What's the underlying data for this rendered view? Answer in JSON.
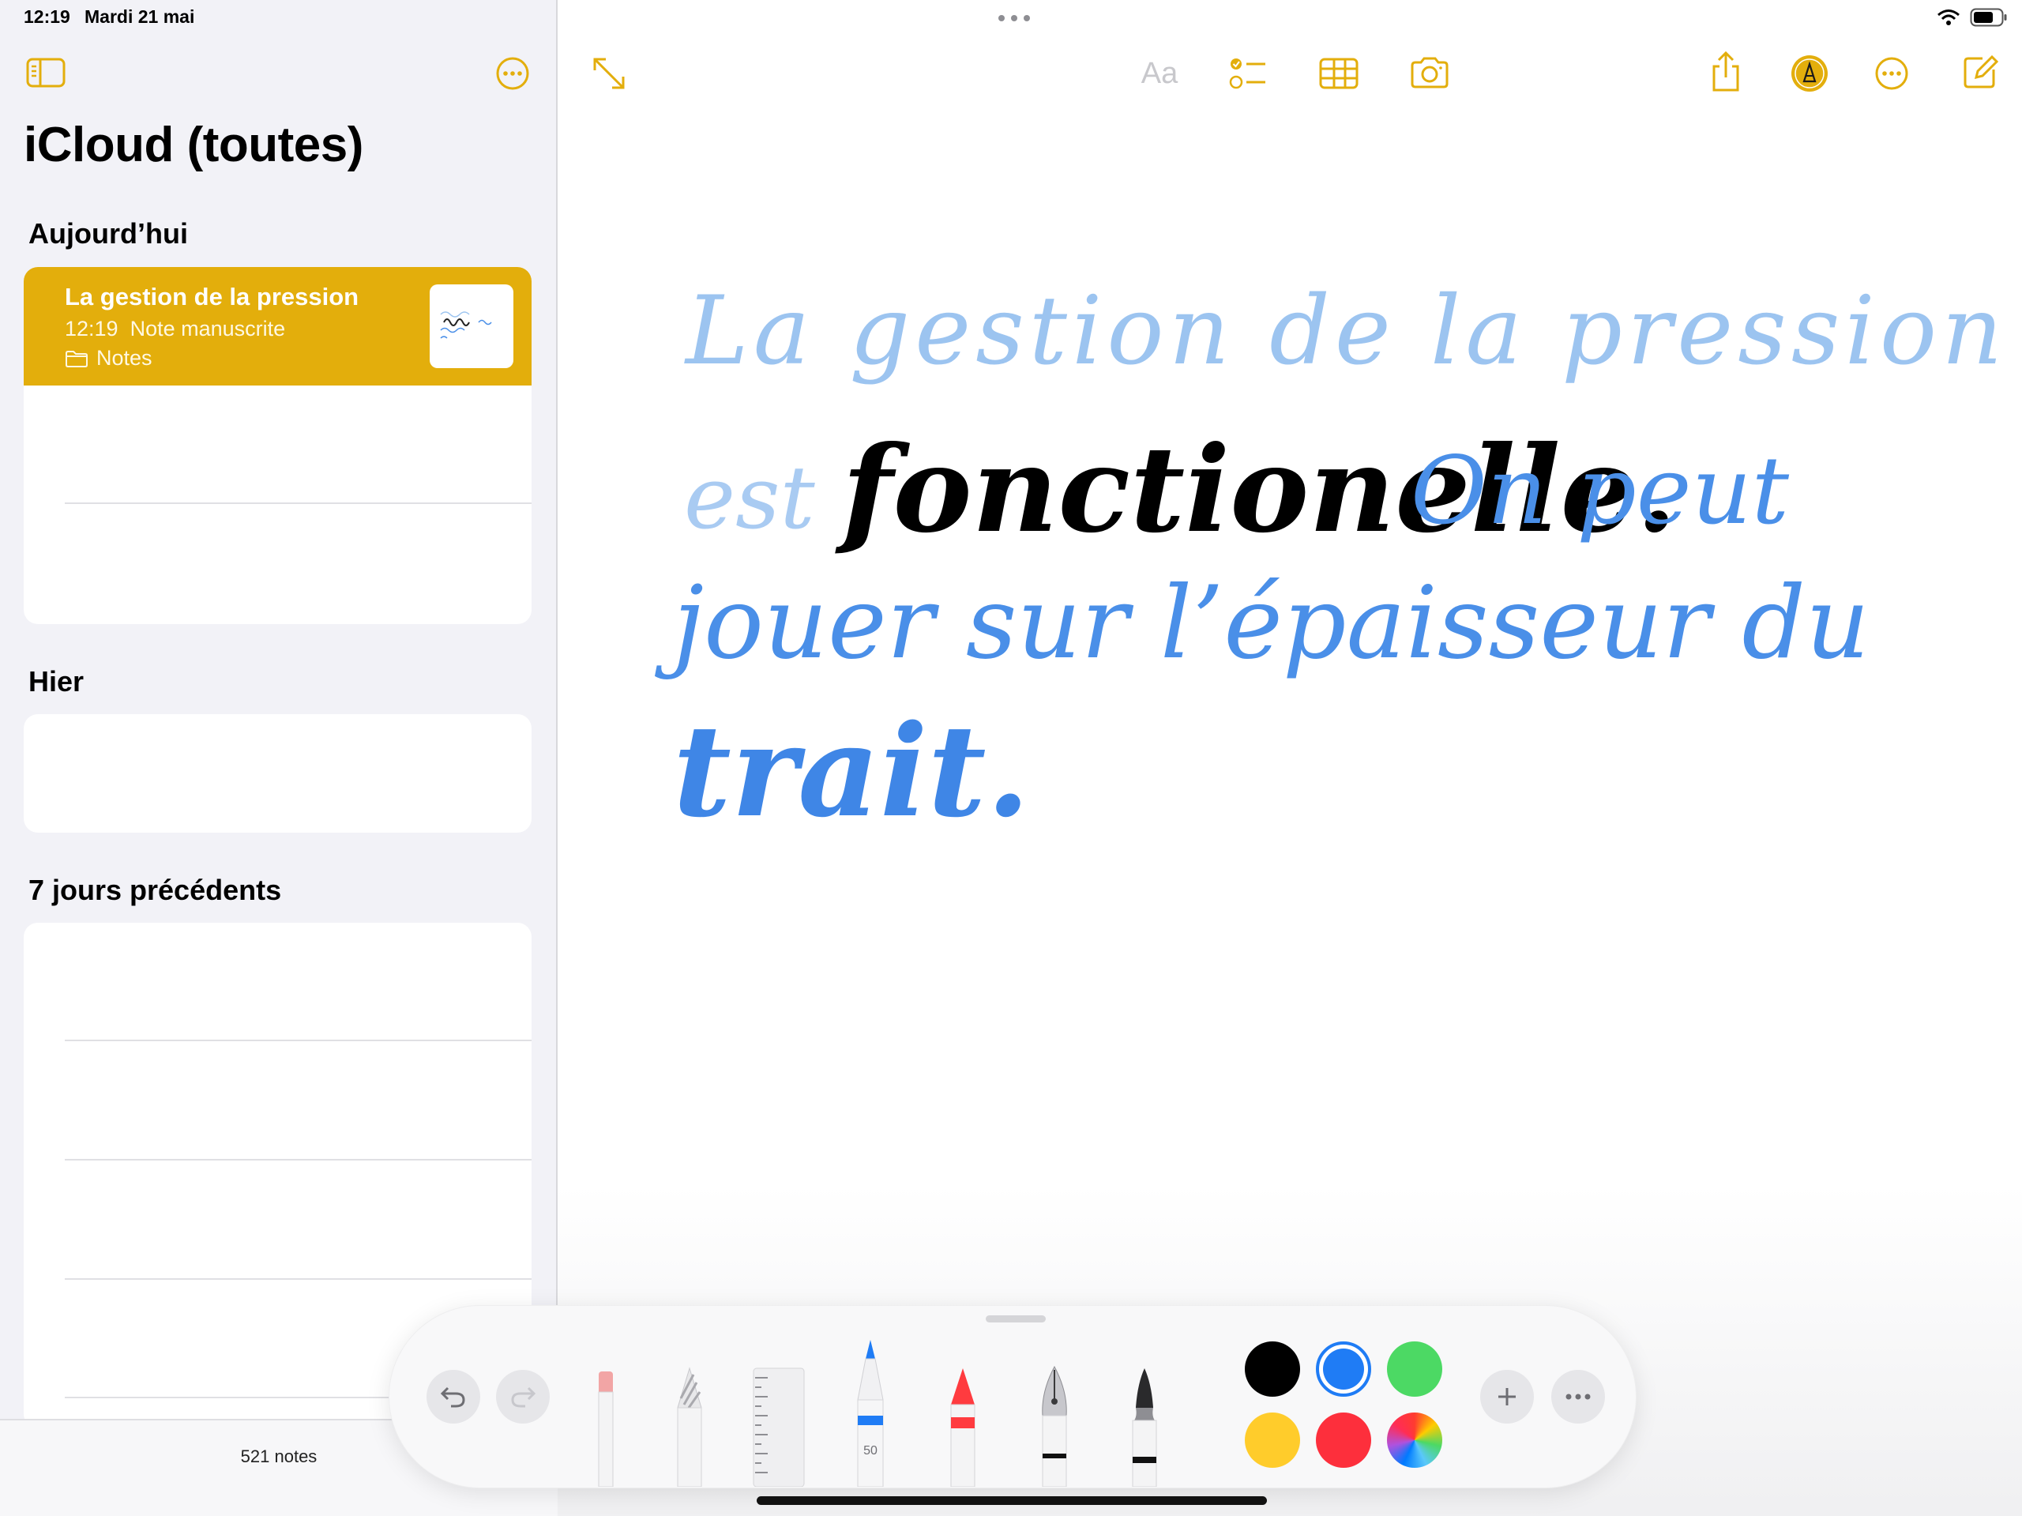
{
  "status_bar": {
    "time": "12:19",
    "date": "Mardi 21 mai"
  },
  "sidebar": {
    "title": "iCloud (toutes)",
    "sections": [
      {
        "header": "Aujourd’hui"
      },
      {
        "header": "Hier"
      },
      {
        "header": "7 jours précédents"
      }
    ],
    "selected_note": {
      "title": "La gestion de la pression",
      "time": "12:19",
      "subtitle": "Note manuscrite",
      "folder": "Notes"
    },
    "notes_count": "521 notes"
  },
  "toolbar": {
    "format_label": "Aa"
  },
  "handwriting": {
    "line1": "La gestion de la pression",
    "line2a": "est",
    "line2b": "fonctionelle.",
    "line2c": "On peut",
    "line3": "jouer sur l’épaisseur du",
    "line4": "trait."
  },
  "palette": {
    "pen_width_label": "50",
    "colors": {
      "black": "#000000",
      "blue": "#1f7cf5",
      "green": "#4cd964",
      "yellow": "#ffcc2b",
      "red": "#fd2f3c"
    }
  },
  "theme": {
    "accent": "#e3ae0c",
    "ink_blue": "#4a8fe8",
    "ink_light_blue": "#9cc4f0"
  }
}
